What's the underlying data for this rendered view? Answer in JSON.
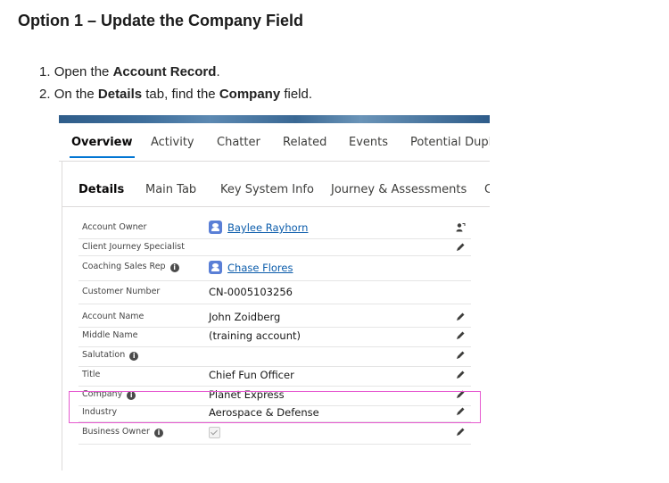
{
  "doc": {
    "heading": "Option 1 – Update the Company Field",
    "steps": [
      {
        "num": "1.",
        "pre": "Open the ",
        "bold": "Account Record",
        "post": "."
      },
      {
        "num": "2.",
        "pre": "On the ",
        "bold": "Details",
        "mid": " tab, find the ",
        "bold2": "Company",
        "post": " field."
      }
    ]
  },
  "record": {
    "top_tabs": [
      "Overview",
      "Activity",
      "Chatter",
      "Related",
      "Events",
      "Potential Dupli"
    ],
    "active_top_tab": "Overview",
    "detail_tabs": [
      "Details",
      "Main Tab",
      "Key System Info",
      "Journey & Assessments",
      "C"
    ],
    "active_detail_tab": "Details",
    "fields": [
      {
        "label": "Account Owner",
        "value": "Baylee Rayhorn",
        "type": "user",
        "action": "change-owner-icon"
      },
      {
        "label": "Client Journey Specialist",
        "value": "",
        "action": "pencil-icon"
      },
      {
        "label": "Coaching Sales Rep",
        "info": true,
        "value": "Chase Flores",
        "type": "user"
      },
      {
        "label": "Customer Number",
        "value": "CN-0005103256"
      },
      {
        "label": "Account Name",
        "value": "John Zoidberg",
        "action": "pencil-icon"
      },
      {
        "label": "Middle Name",
        "value": "(training account)",
        "action": "pencil-icon"
      },
      {
        "label": "Salutation",
        "info": true,
        "value": "",
        "action": "pencil-icon"
      },
      {
        "label": "Title",
        "value": "Chief Fun Officer",
        "action": "pencil-icon"
      },
      {
        "label": "Company",
        "info": true,
        "value": "Planet Express",
        "action": "pencil-icon"
      },
      {
        "label": "Industry",
        "value": "Aerospace & Defense",
        "action": "pencil-icon"
      },
      {
        "label": "Business Owner",
        "info": true,
        "value": "",
        "type": "checkbox",
        "checked": true,
        "action": "pencil-icon"
      }
    ],
    "highlight_color": "#e65ad0",
    "link_color": "#0b5cab",
    "accent_color": "#0176d3"
  }
}
